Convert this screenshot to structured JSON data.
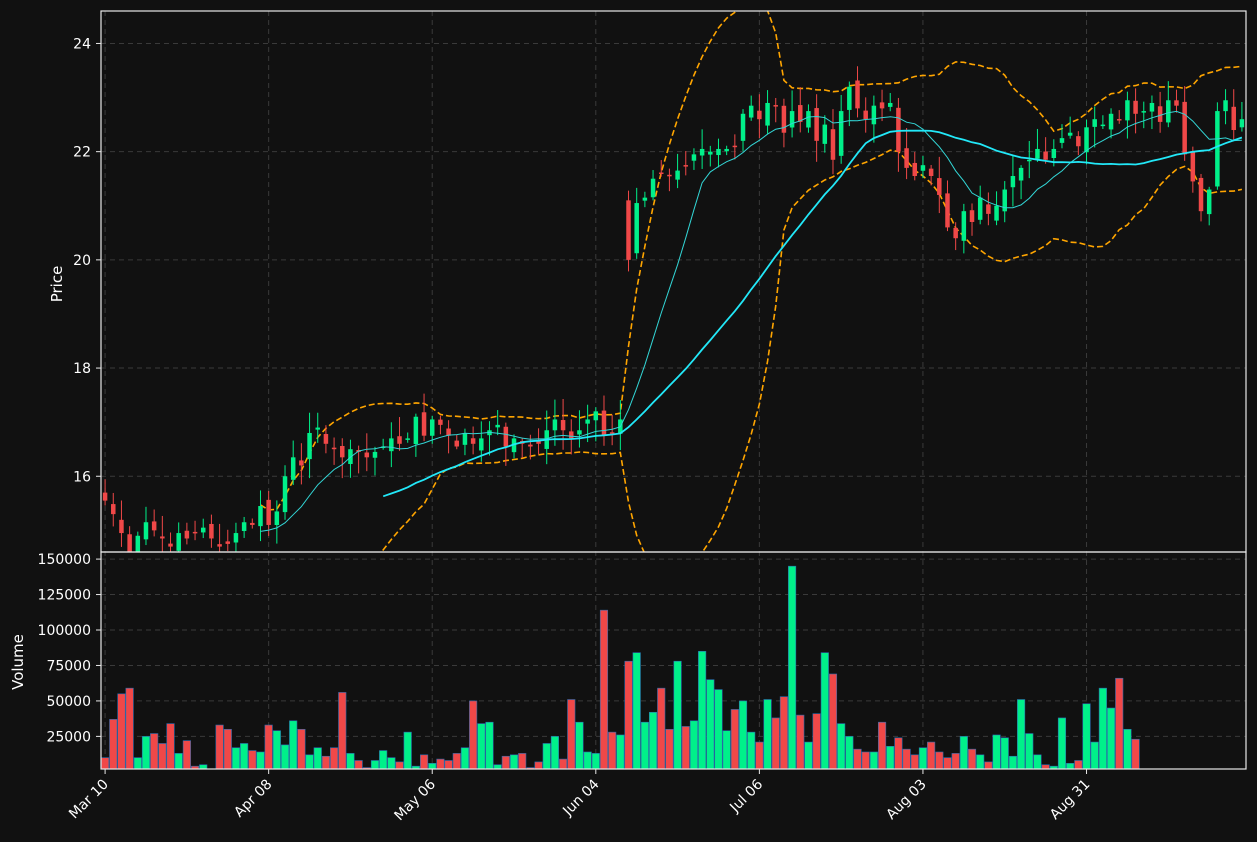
{
  "chart_data": [
    {
      "type": "candlestick",
      "title": "",
      "ylabel": "Price",
      "ylim": [
        14.6,
        24.6
      ],
      "yticks": [
        "16",
        "18",
        "20",
        "22",
        "24"
      ],
      "xticks": [
        "Mar 10",
        "Apr 08",
        "May 06",
        "Jun 04",
        "Jul 06",
        "Aug 03",
        "Aug 31"
      ],
      "grid": true,
      "colors": {
        "up": "#00f08a",
        "down": "#f04848",
        "ma_fast": "#33d6d6",
        "ma_slow": "#22e8f8",
        "bands": "#ffa500",
        "background": "#111111"
      },
      "close": [
        15.55,
        15.3,
        14.95,
        14.55,
        14.9,
        15.15,
        15.0,
        14.85,
        14.7,
        14.95,
        14.85,
        14.95,
        15.05,
        14.85,
        14.7,
        14.75,
        14.95,
        15.15,
        15.1,
        15.45,
        15.1,
        15.35,
        16.0,
        16.35,
        16.2,
        16.8,
        16.9,
        16.6,
        16.5,
        16.35,
        16.5,
        16.45,
        16.35,
        16.45,
        16.55,
        16.7,
        16.6,
        16.7,
        17.1,
        16.75,
        17.05,
        16.95,
        16.75,
        16.55,
        16.8,
        16.6,
        16.7,
        16.85,
        16.95,
        16.55,
        16.7,
        16.6,
        16.55,
        16.6,
        16.85,
        17.05,
        16.85,
        16.7,
        16.85,
        17.05,
        17.2,
        16.75,
        16.8,
        17.05,
        20.0,
        21.05,
        21.15,
        21.5,
        21.6,
        21.55,
        21.65,
        21.75,
        21.95,
        22.05,
        22.0,
        22.05,
        22.05,
        22.1,
        22.7,
        22.85,
        22.6,
        22.9,
        22.85,
        22.35,
        22.75,
        22.55,
        22.75,
        22.2,
        22.5,
        21.85,
        22.75,
        23.2,
        22.8,
        22.6,
        22.85,
        22.8,
        22.9,
        22.0,
        21.7,
        21.55,
        21.75,
        21.55,
        21.2,
        20.6,
        20.4,
        20.9,
        20.7,
        21.15,
        20.85,
        21.0,
        21.3,
        21.55,
        21.7,
        21.85,
        22.05,
        21.85,
        22.05,
        22.25,
        22.35,
        22.1,
        22.45,
        22.6,
        22.5,
        22.7,
        22.6,
        22.95,
        22.7,
        22.75,
        22.9,
        22.55,
        22.95,
        22.85,
        21.95,
        21.45,
        20.9,
        21.3,
        22.75,
        22.95,
        22.4,
        22.6
      ]
    },
    {
      "type": "bar",
      "title": "",
      "ylabel": "Volume",
      "ylim": [
        2000,
        155000
      ],
      "yticks": [
        "25000",
        "50000",
        "75000",
        "100000",
        "125000",
        "150000"
      ],
      "grid": true,
      "values": [
        10000,
        37000,
        55000,
        59000,
        10000,
        25000,
        27000,
        20000,
        34000,
        13000,
        22000,
        4000,
        5000,
        2000,
        33000,
        30000,
        17000,
        20000,
        15000,
        14000,
        33000,
        29000,
        19000,
        36000,
        30000,
        12000,
        17000,
        11000,
        17000,
        56000,
        13000,
        8000,
        3000,
        8000,
        15000,
        10000,
        7000,
        28000,
        4000,
        12000,
        6000,
        9000,
        8000,
        13000,
        17000,
        50000,
        34000,
        35000,
        5000,
        11000,
        12000,
        13000,
        3000,
        7000,
        20000,
        25000,
        9000,
        51000,
        35000,
        14000,
        13000,
        114000,
        28000,
        26000,
        78000,
        84000,
        35000,
        42000,
        59000,
        30000,
        78000,
        32000,
        36000,
        85000,
        65000,
        58000,
        29000,
        44000,
        50000,
        28000,
        21000,
        51000,
        38000,
        53000,
        145000,
        40000,
        21000,
        41000,
        84000,
        69000,
        34000,
        25000,
        16000,
        14000,
        14000,
        35000,
        18000,
        24000,
        16000,
        12000,
        17000,
        21000,
        14000,
        10000,
        13000,
        25000,
        16000,
        12000,
        7000,
        26000,
        24000,
        11000,
        51000,
        27000,
        12000,
        5000,
        4000,
        38000,
        6000,
        8000,
        48000,
        21000,
        59000,
        45000,
        66000,
        30000,
        23000
      ]
    }
  ]
}
